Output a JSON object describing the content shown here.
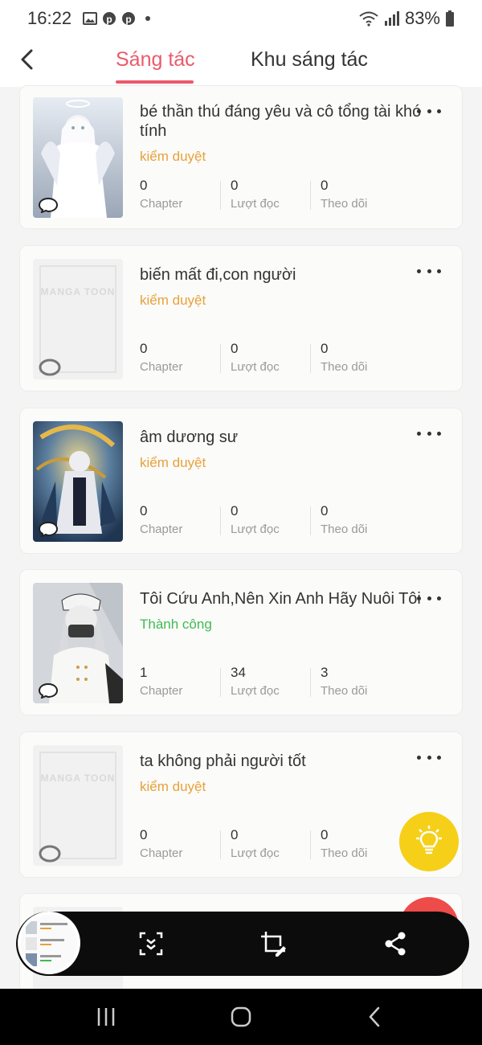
{
  "status_bar": {
    "time": "16:22",
    "battery": "83%",
    "notification_icons": [
      "image-icon",
      "pinterest-icon",
      "pinterest-icon",
      "dot-icon"
    ]
  },
  "header": {
    "tabs": [
      {
        "label": "Sáng tác",
        "active": true
      },
      {
        "label": "Khu sáng tác",
        "active": false
      }
    ]
  },
  "stats_labels": {
    "chapter": "Chapter",
    "reads": "Lượt đọc",
    "follows": "Theo dõi"
  },
  "works": [
    {
      "title": "bé thần thú đáng yêu và cô tổng tài khó tính",
      "status": "kiểm duyệt",
      "status_color": "#e8a13a",
      "chapters": "0",
      "reads": "0",
      "follows": "0",
      "cover": "anime-white-hair-girl"
    },
    {
      "title": "biến mất đi,con người",
      "status": "kiểm duyệt",
      "status_color": "#e8a13a",
      "chapters": "0",
      "reads": "0",
      "follows": "0",
      "cover": "mangatoon-placeholder",
      "cover_text": "MANGA TOON"
    },
    {
      "title": "âm dương sư",
      "status": "kiểm duyệt",
      "status_color": "#e8a13a",
      "chapters": "0",
      "reads": "0",
      "follows": "0",
      "cover": "anime-onmyoji"
    },
    {
      "title": "Tôi Cứu Anh,Nên Xin Anh Hãy Nuôi Tôi",
      "status": "Thành công",
      "status_color": "#3fba52",
      "chapters": "1",
      "reads": "34",
      "follows": "3",
      "cover": "anime-officer-girl"
    },
    {
      "title": "ta không phải người tốt",
      "status": "kiểm duyệt",
      "status_color": "#e8a13a",
      "chapters": "0",
      "reads": "0",
      "follows": "0",
      "cover": "mangatoon-placeholder",
      "cover_text": "MANGA TOON"
    }
  ],
  "colors": {
    "accent": "#ea5a6a",
    "pending": "#e8a13a",
    "success": "#3fba52",
    "fab": "#f6cf18"
  },
  "screenshot_toolbar": {
    "icons": [
      "scroll-capture-icon",
      "crop-edit-icon",
      "share-icon"
    ]
  },
  "nav_bar": {
    "icons": [
      "recents-icon",
      "home-icon",
      "back-icon"
    ]
  }
}
